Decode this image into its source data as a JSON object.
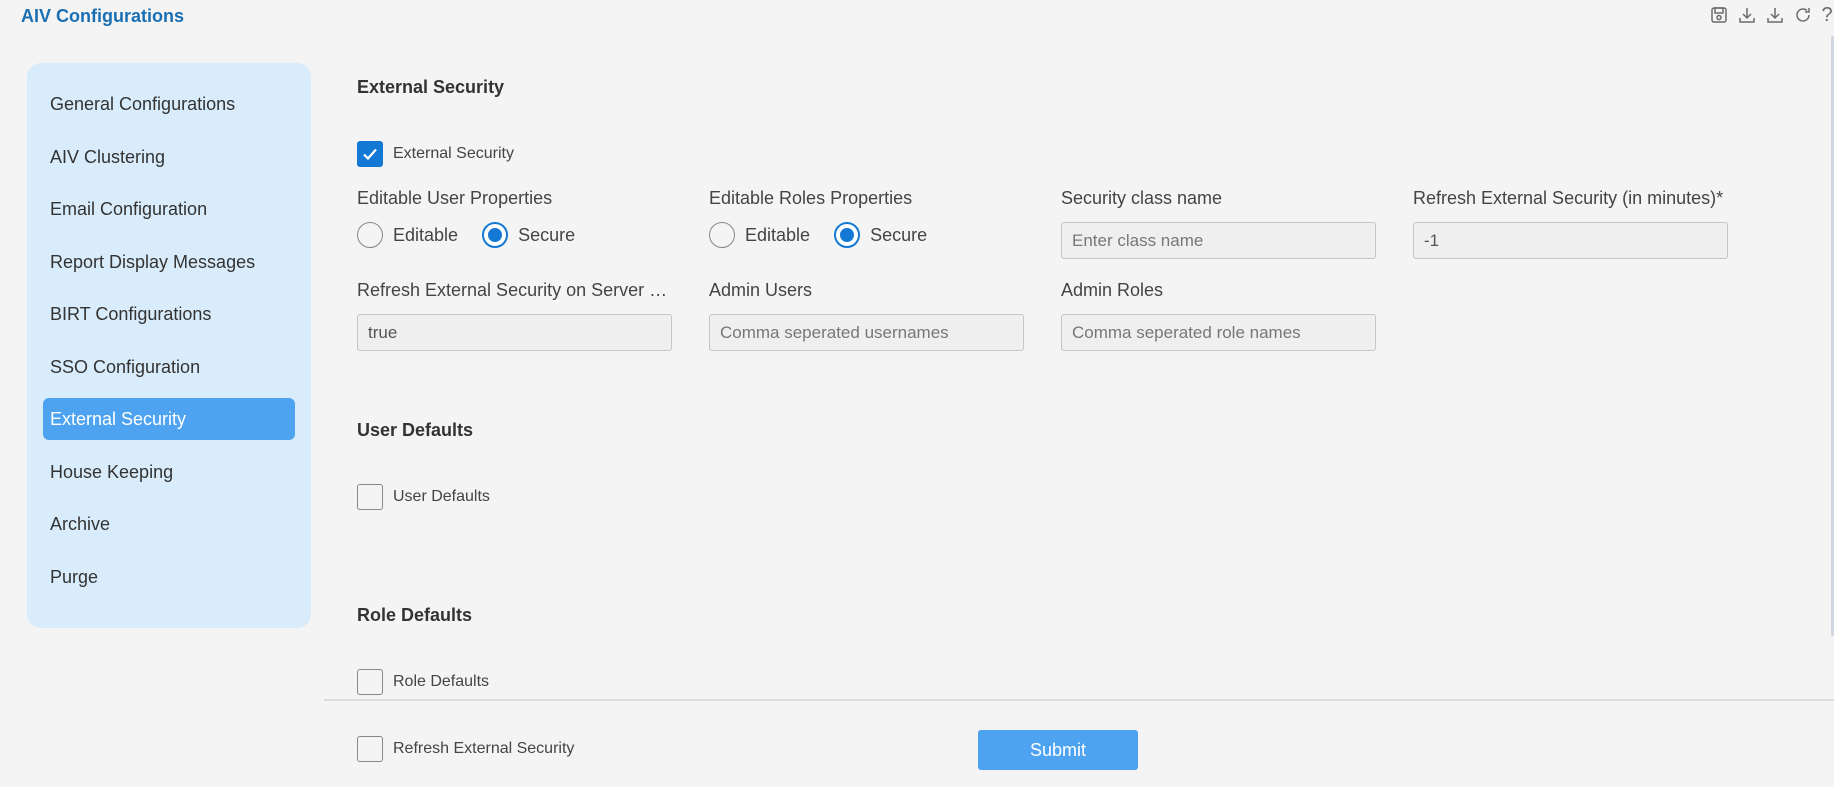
{
  "app": {
    "title": "AIV Configurations"
  },
  "toolbar": {
    "icons": [
      "save-icon",
      "download-icon",
      "download-alt-icon",
      "refresh-icon",
      "help-icon"
    ],
    "help_glyph": "?"
  },
  "sidebar": {
    "items": [
      {
        "label": "General Configurations",
        "active": false
      },
      {
        "label": "AIV Clustering",
        "active": false
      },
      {
        "label": "Email Configuration",
        "active": false
      },
      {
        "label": "Report Display Messages",
        "active": false
      },
      {
        "label": "BIRT Configurations",
        "active": false
      },
      {
        "label": "SSO Configuration",
        "active": false
      },
      {
        "label": "External Security",
        "active": true
      },
      {
        "label": "House Keeping",
        "active": false
      },
      {
        "label": "Archive",
        "active": false
      },
      {
        "label": "Purge",
        "active": false
      }
    ]
  },
  "external_security": {
    "section_title": "External Security",
    "enable_label": "External Security",
    "enabled": true,
    "editable_user_properties": {
      "label": "Editable User Properties",
      "option_editable": "Editable",
      "option_secure": "Secure",
      "selected": "Secure"
    },
    "editable_roles_properties": {
      "label": "Editable Roles Properties",
      "option_editable": "Editable",
      "option_secure": "Secure",
      "selected": "Secure"
    },
    "security_class_name": {
      "label": "Security class name",
      "value": "",
      "placeholder": "Enter class name"
    },
    "refresh_minutes": {
      "label": "Refresh External Security (in minutes)*",
      "value": "-1"
    },
    "refresh_on_startup": {
      "label": "Refresh External Security on Server Startup",
      "value": "true"
    },
    "admin_users": {
      "label": "Admin Users",
      "value": "",
      "placeholder": "Comma seperated usernames"
    },
    "admin_roles": {
      "label": "Admin Roles",
      "value": "",
      "placeholder": "Comma seperated role names"
    }
  },
  "user_defaults": {
    "section_title": "User Defaults",
    "checkbox_label": "User Defaults",
    "checked": false
  },
  "role_defaults": {
    "section_title": "Role Defaults",
    "checkbox_label": "Role Defaults",
    "checked": false
  },
  "footer": {
    "refresh_label": "Refresh External Security",
    "refresh_checked": false,
    "submit_label": "Submit"
  },
  "colors": {
    "accent": "#1479d4",
    "active_item": "#4ea3f0",
    "sidebar_bg": "#d9ecfb",
    "title": "#1a6fb3"
  }
}
